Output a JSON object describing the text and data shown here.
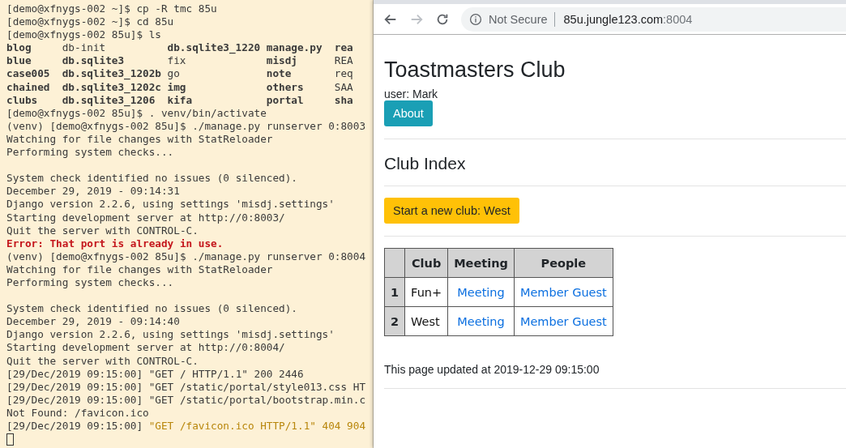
{
  "terminal": {
    "lines": [
      {
        "segments": [
          {
            "text": "[demo@xfnygs-002 ~]$ cp -R tmc 85u",
            "kind": "normal"
          }
        ]
      },
      {
        "segments": [
          {
            "text": "[demo@xfnygs-002 ~]$ cd 85u",
            "kind": "normal"
          }
        ]
      },
      {
        "segments": [
          {
            "text": "[demo@xfnygs-002 85u]$ ls",
            "kind": "normal"
          }
        ]
      },
      {
        "listing": [
          [
            {
              "text": "blog",
              "bold": true
            },
            {
              "text": "db-init",
              "bold": false
            },
            {
              "text": "db.sqlite3_1220",
              "bold": true
            },
            {
              "text": "manage.py",
              "bold": true
            },
            {
              "text": "rea",
              "bold": true
            }
          ],
          [
            {
              "text": "blue",
              "bold": true
            },
            {
              "text": "db.sqlite3",
              "bold": true
            },
            {
              "text": "fix",
              "bold": false
            },
            {
              "text": "misdj",
              "bold": true
            },
            {
              "text": "REA",
              "bold": false
            }
          ],
          [
            {
              "text": "case005",
              "bold": true
            },
            {
              "text": "db.sqlite3_1202b",
              "bold": true
            },
            {
              "text": "go",
              "bold": false
            },
            {
              "text": "note",
              "bold": true
            },
            {
              "text": "req",
              "bold": false
            }
          ],
          [
            {
              "text": "chained",
              "bold": true
            },
            {
              "text": "db.sqlite3_1202c",
              "bold": true
            },
            {
              "text": "img",
              "bold": true
            },
            {
              "text": "others",
              "bold": true
            },
            {
              "text": "SAA",
              "bold": false
            }
          ],
          [
            {
              "text": "clubs",
              "bold": true
            },
            {
              "text": "db.sqlite3_1206",
              "bold": true
            },
            {
              "text": "kifa",
              "bold": true
            },
            {
              "text": "portal",
              "bold": true
            },
            {
              "text": "sha",
              "bold": true
            }
          ]
        ]
      },
      {
        "segments": [
          {
            "text": "[demo@xfnygs-002 85u]$ . venv/bin/activate",
            "kind": "normal"
          }
        ]
      },
      {
        "segments": [
          {
            "text": "(venv) [demo@xfnygs-002 85u]$ ./manage.py runserver 0:8003",
            "kind": "normal"
          }
        ]
      },
      {
        "segments": [
          {
            "text": "Watching for file changes with StatReloader",
            "kind": "normal"
          }
        ]
      },
      {
        "segments": [
          {
            "text": "Performing system checks...",
            "kind": "normal"
          }
        ]
      },
      {
        "gap_before": true,
        "segments": [
          {
            "text": "System check identified no issues (0 silenced).",
            "kind": "normal"
          }
        ]
      },
      {
        "segments": [
          {
            "text": "December 29, 2019 - 09:14:31",
            "kind": "normal"
          }
        ]
      },
      {
        "segments": [
          {
            "text": "Django version 2.2.6, using settings 'misdj.settings'",
            "kind": "normal"
          }
        ]
      },
      {
        "segments": [
          {
            "text": "Starting development server at http://0:8003/",
            "kind": "normal"
          }
        ]
      },
      {
        "segments": [
          {
            "text": "Quit the server with CONTROL-C.",
            "kind": "normal"
          }
        ]
      },
      {
        "segments": [
          {
            "text": "Error: That port is already in use.",
            "kind": "error"
          }
        ]
      },
      {
        "segments": [
          {
            "text": "(venv) [demo@xfnygs-002 85u]$ ./manage.py runserver 0:8004",
            "kind": "normal"
          }
        ]
      },
      {
        "segments": [
          {
            "text": "Watching for file changes with StatReloader",
            "kind": "normal"
          }
        ]
      },
      {
        "segments": [
          {
            "text": "Performing system checks...",
            "kind": "normal"
          }
        ]
      },
      {
        "gap_before": true,
        "segments": [
          {
            "text": "System check identified no issues (0 silenced).",
            "kind": "normal"
          }
        ]
      },
      {
        "segments": [
          {
            "text": "December 29, 2019 - 09:14:40",
            "kind": "normal"
          }
        ]
      },
      {
        "segments": [
          {
            "text": "Django version 2.2.6, using settings 'misdj.settings'",
            "kind": "normal"
          }
        ]
      },
      {
        "segments": [
          {
            "text": "Starting development server at http://0:8004/",
            "kind": "normal"
          }
        ]
      },
      {
        "segments": [
          {
            "text": "Quit the server with CONTROL-C.",
            "kind": "normal"
          }
        ]
      },
      {
        "segments": [
          {
            "text": "[29/Dec/2019 09:15:00] \"GET / HTTP/1.1\" 200 2446",
            "kind": "normal"
          }
        ]
      },
      {
        "segments": [
          {
            "text": "[29/Dec/2019 09:15:00] \"GET /static/portal/style013.css HT",
            "kind": "normal"
          }
        ]
      },
      {
        "segments": [
          {
            "text": "[29/Dec/2019 09:15:00] \"GET /static/portal/bootstrap.min.c",
            "kind": "normal"
          }
        ]
      },
      {
        "segments": [
          {
            "text": "Not Found: /favicon.ico",
            "kind": "normal"
          }
        ]
      },
      {
        "segments": [
          {
            "text": "[29/Dec/2019 09:15:00] ",
            "kind": "normal"
          },
          {
            "text": "\"GET /favicon.ico HTTP/1.1\" 404 904",
            "kind": "warning"
          }
        ]
      }
    ],
    "cursor": true
  },
  "browser": {
    "address": {
      "security": "Not Secure",
      "host": "85u.jungle123.com",
      "port": ":8004"
    },
    "page": {
      "title": "Toastmasters Club",
      "user": "user: Mark",
      "about_button": "About",
      "section_title": "Club Index",
      "new_club_button": "Start a new club: West",
      "table": {
        "columns": [
          "",
          "Club",
          "Meeting",
          "People"
        ],
        "rows": [
          {
            "index": "1",
            "club": "Fun+",
            "meeting": "Meeting",
            "people": [
              "Member",
              "Guest"
            ]
          },
          {
            "index": "2",
            "club": "West",
            "meeting": "Meeting",
            "people": [
              "Member",
              "Guest"
            ]
          }
        ]
      },
      "updated": "This page updated at 2019-12-29 09:15:00"
    }
  }
}
